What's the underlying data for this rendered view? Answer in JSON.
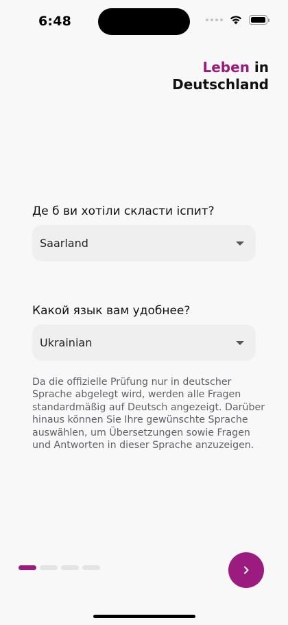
{
  "status_bar": {
    "time": "6:48",
    "icons": [
      "cellular-signal-icon",
      "wifi-icon",
      "battery-icon"
    ]
  },
  "logo": {
    "line1_accent": "Leben",
    "line1_rest": " in",
    "line2": "Deutschland",
    "accent_color": "#9b1b7f"
  },
  "exam_state": {
    "question": "Де б ви хотіли скласти іспит?",
    "selected": "Saarland"
  },
  "language": {
    "question": "Какой язык вам удобнее?",
    "selected": "Ukrainian"
  },
  "info_text": "Da die offizielle Prüfung nur in deutscher Sprache abgelegt wird, werden alle Fragen standardmäßig auf Deutsch angezeigt. Darüber hinaus können Sie Ihre gewünschte Sprache auswählen, um Übersetzungen sowie Fragen und Antworten in dieser Sprache anzuzeigen.",
  "pager": {
    "total_pages": 4,
    "active_page": 1
  },
  "next_button": {
    "icon": "chevron-right-icon",
    "color": "#9b1b7f"
  }
}
